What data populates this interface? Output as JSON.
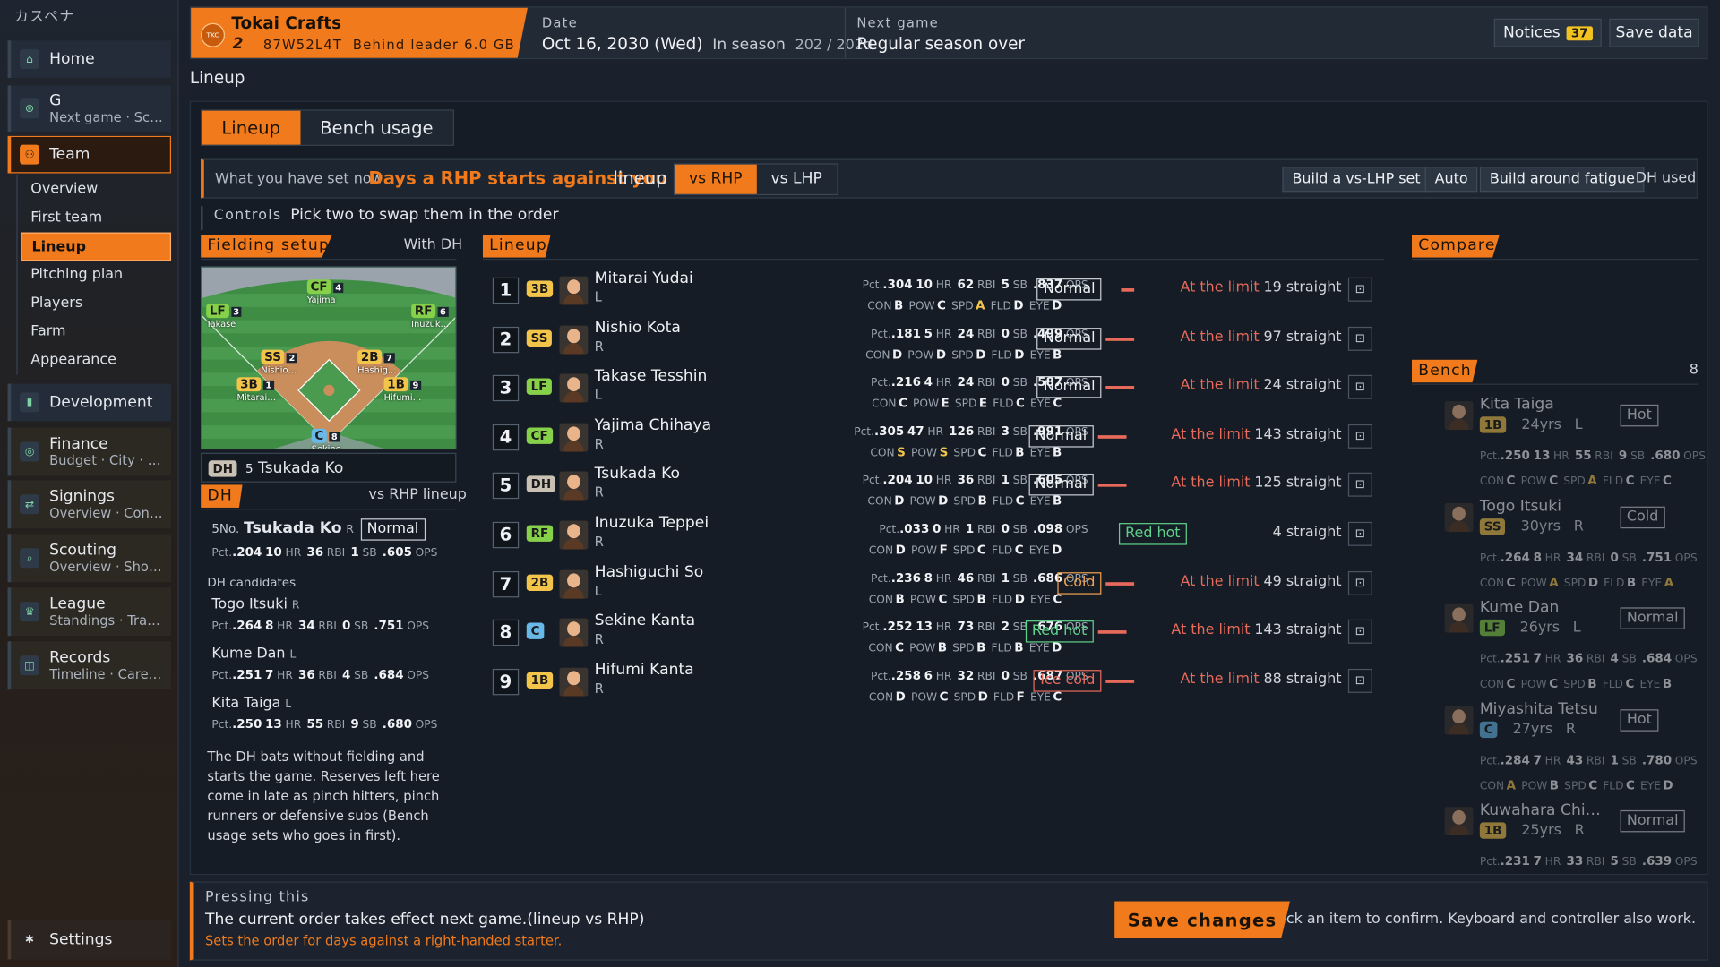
{
  "app": {
    "brand": "カスペナ"
  },
  "nav": [
    {
      "title": "Home",
      "sub": "",
      "icon": "home-icon",
      "glyph": "⌂"
    },
    {
      "title": "G",
      "sub": "Next game · Sc…",
      "icon": "game-icon",
      "glyph": "⊛"
    },
    {
      "title": "Team",
      "sub": "",
      "icon": "team-icon",
      "glyph": "⚇"
    },
    {
      "title": "Development",
      "sub": "",
      "icon": "chart-icon",
      "glyph": "▮"
    },
    {
      "title": "Finance",
      "sub": "Budget · City · B…",
      "icon": "coin-icon",
      "glyph": "◎"
    },
    {
      "title": "Signings",
      "sub": "Overview · Cont…",
      "icon": "swap-icon",
      "glyph": "⇄"
    },
    {
      "title": "Scouting",
      "sub": "Overview · Shor…",
      "icon": "search-icon",
      "glyph": "⌕"
    },
    {
      "title": "League",
      "sub": "Standings · Tran…",
      "icon": "trophy-icon",
      "glyph": "♛"
    },
    {
      "title": "Records",
      "sub": "Timeline · Care…",
      "icon": "book-icon",
      "glyph": "◫"
    }
  ],
  "subnav": [
    "Overview",
    "First team",
    "Lineup",
    "Pitching plan",
    "Players",
    "Farm",
    "Appearance"
  ],
  "settings": {
    "label": "Settings",
    "glyph": "✱"
  },
  "header": {
    "team_name": "Tokai Crafts",
    "logo_text": "TKC",
    "rank": "2",
    "record": "87W52L4T",
    "behind": "Behind leader 6.0 GB",
    "date_label": "Date",
    "date": "Oct 16, 2030 (Wed)",
    "season": "In season",
    "season_count": "202 / 202d",
    "next_label": "Next game",
    "next_value": "Regular season over",
    "notices_label": "Notices",
    "notices_count": "37",
    "save_label": "Save data"
  },
  "page_title": "Lineup",
  "tabs": [
    "Lineup",
    "Bench usage"
  ],
  "setbar": {
    "prefix": "What you have set now",
    "highlight": "Days a RHP starts against you",
    "suffix": "lineup",
    "seg": [
      "vs RHP",
      "vs LHP"
    ],
    "buttons": [
      "Build a vs-LHP set",
      "Auto",
      "Build around fatigue"
    ],
    "dh_used": "DH used"
  },
  "controls": {
    "label": "Controls",
    "text": "Pick two to swap them in the order"
  },
  "fielding": {
    "title": "Fielding setup",
    "mode": "With DH",
    "positions": [
      {
        "pos": "CF",
        "cls": "pcf",
        "no": "4",
        "name": "Yajima"
      },
      {
        "pos": "LF",
        "cls": "plf",
        "no": "3",
        "name": "Takase"
      },
      {
        "pos": "RF",
        "cls": "prf",
        "no": "6",
        "name": "Inuzuk…"
      },
      {
        "pos": "SS",
        "cls": "pss",
        "no": "2",
        "name": "Nishio…"
      },
      {
        "pos": "2B",
        "cls": "p2b",
        "no": "7",
        "name": "Hashig…"
      },
      {
        "pos": "3B",
        "cls": "p3b",
        "no": "1",
        "name": "Mitarai…"
      },
      {
        "pos": "1B",
        "cls": "p1b",
        "no": "9",
        "name": "Hifumi…"
      },
      {
        "pos": "C",
        "cls": "pc",
        "no": "8",
        "name": "Sekine…"
      }
    ],
    "dh_pos": "DH",
    "dh_no": "5",
    "dh_name": "Tsukada Ko"
  },
  "dh": {
    "title": "DH",
    "context": "vs RHP lineup",
    "current": {
      "no": "5No.",
      "name": "Tsukada Ko",
      "hand": "R",
      "cond": "Normal",
      "pct": ".204",
      "hr": "10",
      "rbi": "36",
      "sb": "1",
      "ops": ".605"
    },
    "cand_label": "DH candidates",
    "candidates": [
      {
        "name": "Togo Itsuki",
        "hand": "R",
        "pct": ".264",
        "hr": "8",
        "rbi": "34",
        "sb": "0",
        "ops": ".751"
      },
      {
        "name": "Kume Dan",
        "hand": "L",
        "pct": ".251",
        "hr": "7",
        "rbi": "36",
        "sb": "4",
        "ops": ".684"
      },
      {
        "name": "Kita Taiga",
        "hand": "L",
        "pct": ".250",
        "hr": "13",
        "rbi": "55",
        "sb": "9",
        "ops": ".680"
      }
    ],
    "note": "The DH bats without fielding and starts the game. Reserves left here come in late as pinch hitters, pinch runners or defensive subs (Bench usage sets who goes in first)."
  },
  "lineup_title": "Lineup",
  "lineup": [
    {
      "order": "1",
      "pos": "3B",
      "cls": "p3b",
      "name": "Mitarai Yudai",
      "hand": "L",
      "pct": ".304",
      "hr": "10",
      "rbi": "62",
      "sb": "5",
      "ops": ".837",
      "con": "B",
      "pow": "C",
      "spd": "A",
      "fld": "D",
      "eye": "D",
      "cond": "Normal",
      "cond_color": "#c8cdd4",
      "limit": "At the limit",
      "streak": "19 straight",
      "bar_fraction": 0.48
    },
    {
      "order": "2",
      "pos": "SS",
      "cls": "pss",
      "name": "Nishio Kota",
      "hand": "R",
      "pct": ".181",
      "hr": "5",
      "rbi": "24",
      "sb": "0",
      "ops": ".499",
      "con": "D",
      "pow": "D",
      "spd": "D",
      "fld": "D",
      "eye": "B",
      "cond": "Normal",
      "cond_color": "#c8cdd4",
      "limit": "At the limit",
      "streak": "97 straight",
      "bar_fraction": 1
    },
    {
      "order": "3",
      "pos": "LF",
      "cls": "plf",
      "name": "Takase Tesshin",
      "hand": "L",
      "pct": ".216",
      "hr": "4",
      "rbi": "24",
      "sb": "0",
      "ops": ".587",
      "con": "C",
      "pow": "E",
      "spd": "E",
      "fld": "C",
      "eye": "C",
      "cond": "Normal",
      "cond_color": "#c8cdd4",
      "limit": "At the limit",
      "streak": "24 straight",
      "bar_fraction": 1
    },
    {
      "order": "4",
      "pos": "CF",
      "cls": "pcf",
      "name": "Yajima Chihaya",
      "hand": "R",
      "pct": ".305",
      "hr": "47",
      "rbi": "126",
      "sb": "3",
      "ops": ".991",
      "con": "S",
      "pow": "S",
      "spd": "C",
      "fld": "B",
      "eye": "B",
      "cond": "Normal",
      "cond_color": "#c8cdd4",
      "limit": "At the limit",
      "streak": "143 straight",
      "bar_fraction": 1
    },
    {
      "order": "5",
      "pos": "DH",
      "cls": "pdh",
      "name": "Tsukada Ko",
      "hand": "R",
      "pct": ".204",
      "hr": "10",
      "rbi": "36",
      "sb": "1",
      "ops": ".605",
      "con": "D",
      "pow": "D",
      "spd": "B",
      "fld": "C",
      "eye": "B",
      "cond": "Normal",
      "cond_color": "#c8cdd4",
      "limit": "At the limit",
      "streak": "125 straight",
      "bar_fraction": 1
    },
    {
      "order": "6",
      "pos": "RF",
      "cls": "prf",
      "name": "Inuzuka Teppei",
      "hand": "R",
      "pct": ".033",
      "hr": "0",
      "rbi": "1",
      "sb": "0",
      "ops": ".098",
      "con": "D",
      "pow": "F",
      "spd": "C",
      "fld": "C",
      "eye": "D",
      "cond": "Red hot",
      "cond_color": "#5ed18a",
      "limit": "",
      "streak": "4 straight",
      "bar_fraction": 0
    },
    {
      "order": "7",
      "pos": "2B",
      "cls": "p2b",
      "name": "Hashiguchi So",
      "hand": "L",
      "pct": ".236",
      "hr": "8",
      "rbi": "46",
      "sb": "1",
      "ops": ".686",
      "con": "B",
      "pow": "C",
      "spd": "B",
      "fld": "D",
      "eye": "C",
      "cond": "Cold",
      "cond_color": "#f0a050",
      "limit": "At the limit",
      "streak": "49 straight",
      "bar_fraction": 1
    },
    {
      "order": "8",
      "pos": "C",
      "cls": "pc",
      "name": "Sekine Kanta",
      "hand": "R",
      "pct": ".252",
      "hr": "13",
      "rbi": "73",
      "sb": "2",
      "ops": ".676",
      "con": "C",
      "pow": "B",
      "spd": "B",
      "fld": "B",
      "eye": "D",
      "cond": "Red hot",
      "cond_color": "#5ed18a",
      "limit": "At the limit",
      "streak": "143 straight",
      "bar_fraction": 1
    },
    {
      "order": "9",
      "pos": "1B",
      "cls": "p1b",
      "name": "Hifumi Kanta",
      "hand": "R",
      "pct": ".258",
      "hr": "6",
      "rbi": "32",
      "sb": "0",
      "ops": ".687",
      "con": "D",
      "pow": "C",
      "spd": "D",
      "fld": "F",
      "eye": "C",
      "cond": "Ice cold",
      "cond_color": "#e86a5a",
      "limit": "At the limit",
      "streak": "88 straight",
      "bar_fraction": 1
    }
  ],
  "compare_title": "Compare",
  "bench_title": "Bench",
  "bench_count": "8",
  "bench": [
    {
      "name": "Kita Taiga",
      "pos": "1B",
      "cls": "p1b",
      "age": "24yrs",
      "hand": "L",
      "cond": "Hot",
      "pct": ".250",
      "hr": "13",
      "rbi": "55",
      "sb": "9",
      "ops": ".680",
      "con": "C",
      "pow": "C",
      "spd": "A",
      "fld": "C",
      "eye": "C"
    },
    {
      "name": "Togo Itsuki",
      "pos": "SS",
      "cls": "pss",
      "age": "30yrs",
      "hand": "R",
      "cond": "Cold",
      "pct": ".264",
      "hr": "8",
      "rbi": "34",
      "sb": "0",
      "ops": ".751",
      "con": "C",
      "pow": "A",
      "spd": "D",
      "fld": "B",
      "eye": "A"
    },
    {
      "name": "Kume Dan",
      "pos": "LF",
      "cls": "plf",
      "age": "26yrs",
      "hand": "L",
      "cond": "Normal",
      "pct": ".251",
      "hr": "7",
      "rbi": "36",
      "sb": "4",
      "ops": ".684",
      "con": "C",
      "pow": "C",
      "spd": "B",
      "fld": "C",
      "eye": "B"
    },
    {
      "name": "Miyashita Tetsu",
      "pos": "C",
      "cls": "pc",
      "age": "27yrs",
      "hand": "R",
      "cond": "Hot",
      "pct": ".284",
      "hr": "7",
      "rbi": "43",
      "sb": "1",
      "ops": ".780",
      "con": "A",
      "pow": "B",
      "spd": "C",
      "fld": "C",
      "eye": "D"
    },
    {
      "name": "Kuwahara Chi…",
      "pos": "1B",
      "cls": "p1b",
      "age": "25yrs",
      "hand": "R",
      "cond": "Normal",
      "pct": ".231",
      "hr": "7",
      "rbi": "33",
      "sb": "5",
      "ops": ".639",
      "con": "",
      "pow": "",
      "spd": "",
      "fld": "",
      "eye": ""
    }
  ],
  "footer": {
    "label": "Pressing this",
    "line1": "The current order takes effect next game.(lineup vs RHP)",
    "line2": "Sets the order for days against a right-handed starter.",
    "save": "Save changes",
    "hint": "Click an item to confirm. Keyboard and controller also work."
  },
  "stat_labels": {
    "pct": "Pct.",
    "hr": "HR",
    "rbi": "RBI",
    "sb": "SB",
    "ops": "OPS",
    "con": "CON",
    "pow": "POW",
    "spd": "SPD",
    "fld": "FLD",
    "eye": "EYE"
  }
}
